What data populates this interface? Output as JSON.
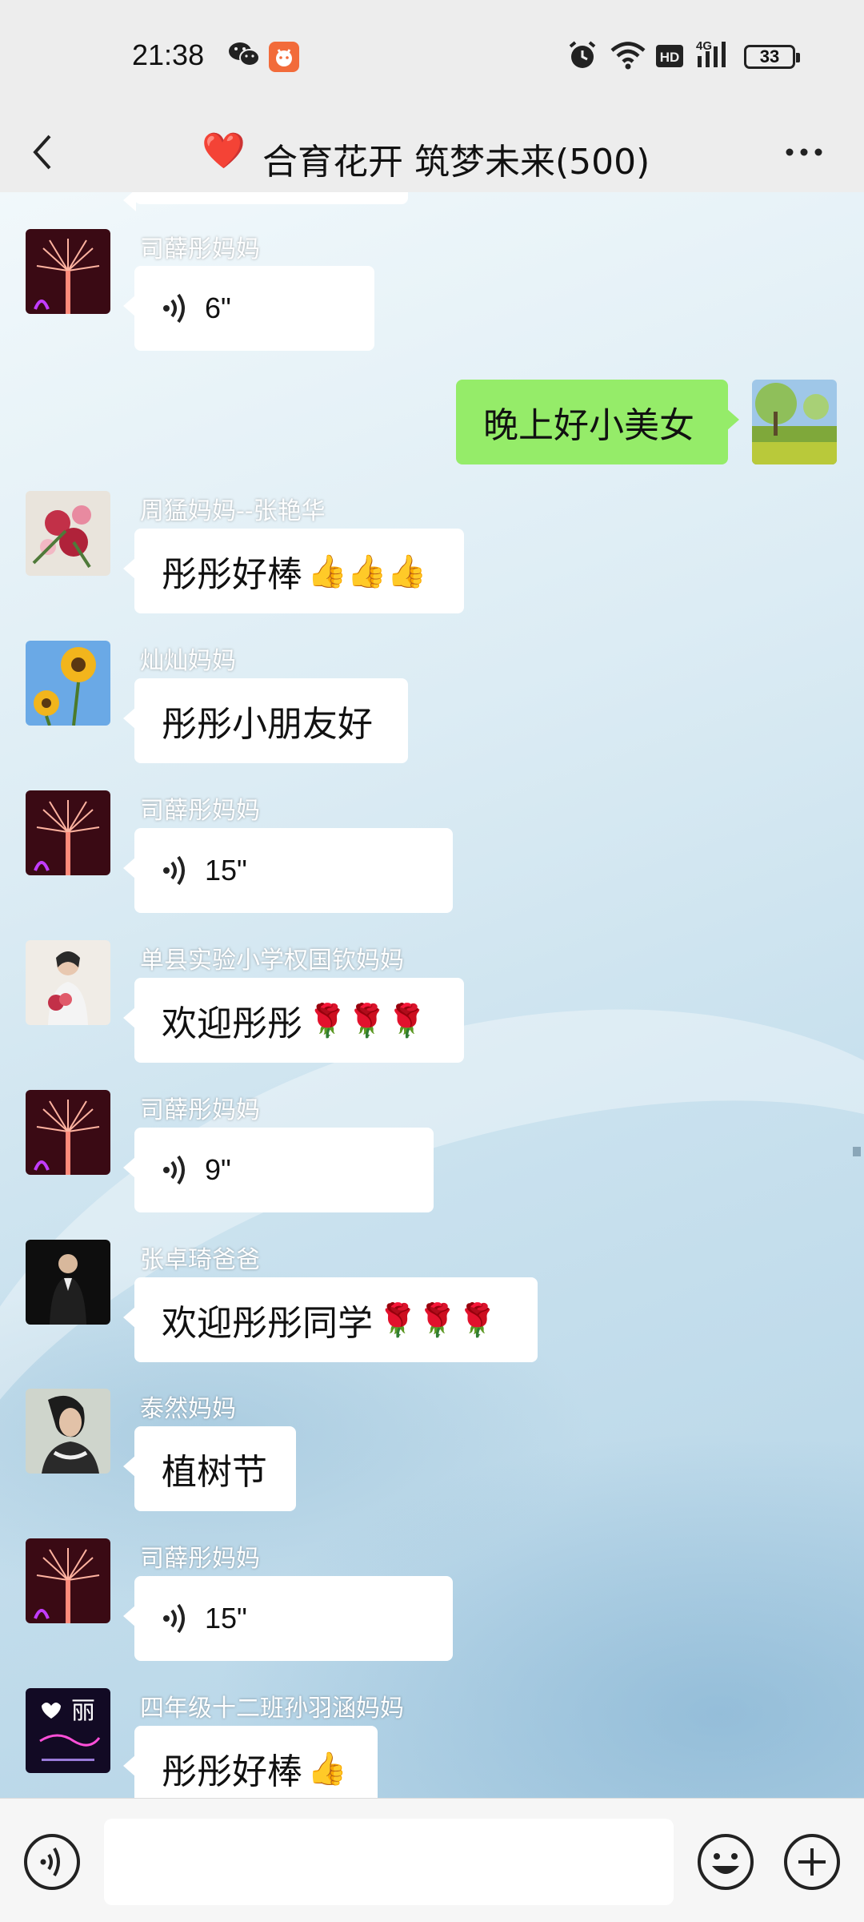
{
  "status_bar": {
    "time": "21:38",
    "network": "4G",
    "hd": "HD",
    "battery": "33",
    "icons": [
      "wechat-icon",
      "app-notification-icon",
      "alarm-icon",
      "wifi-icon",
      "hd-icon",
      "signal-icon",
      "battery-icon"
    ]
  },
  "header": {
    "title": "合育花开 筑梦未来(500)",
    "title_emoji": "❤️",
    "back_icon": "chevron-left-icon",
    "more_icon": "more-dots-icon"
  },
  "messages": [
    {
      "sender": "司薛彤妈妈",
      "type": "voice",
      "duration": "6\""
    },
    {
      "sender": "",
      "type": "text",
      "text": "晚上好小美女",
      "mine": true
    },
    {
      "sender": "周猛妈妈--张艳华",
      "type": "text",
      "text": "彤彤好棒",
      "emoji": "👍👍👍"
    },
    {
      "sender": "灿灿妈妈",
      "type": "text",
      "text": "彤彤小朋友好"
    },
    {
      "sender": "司薛彤妈妈",
      "type": "voice",
      "duration": "15\""
    },
    {
      "sender": "单县实验小学权国钦妈妈",
      "type": "text",
      "text": "欢迎彤彤",
      "emoji": "🌹🌹🌹"
    },
    {
      "sender": "司薛彤妈妈",
      "type": "voice",
      "duration": "9\""
    },
    {
      "sender": "张卓琦爸爸",
      "type": "text",
      "text": "欢迎彤彤同学",
      "emoji": "🌹🌹🌹"
    },
    {
      "sender": "泰然妈妈",
      "type": "text",
      "text": "植树节"
    },
    {
      "sender": "司薛彤妈妈",
      "type": "voice",
      "duration": "15\""
    },
    {
      "sender": "四年级十二班孙羽涵妈妈",
      "type": "text",
      "text": "彤彤好棒",
      "emoji": "👍"
    }
  ],
  "avatar_badge": {
    "text": "丽"
  },
  "input_bar": {
    "placeholder": "",
    "voice_icon": "voice-input-icon",
    "emoji_icon": "smiley-icon",
    "plus_icon": "plus-circle-icon"
  },
  "colors": {
    "bubble_mine": "#95ec69",
    "bubble_other": "#ffffff",
    "title_heart": "#e0192f",
    "bar_bg": "#ededed"
  }
}
